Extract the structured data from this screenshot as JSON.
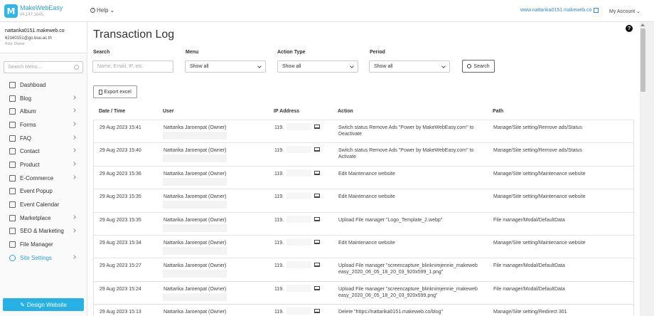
{
  "header": {
    "logo_letter": "M",
    "brand_name": "MakeWebEasy",
    "brand_version": "v4.147.1645",
    "help_label": "Help",
    "site_link": "www.nattarika0151.makeweb.co",
    "account_label": "My Account"
  },
  "sidebar": {
    "user_name": "nattarika0151.makeweb.co",
    "user_email": "62160151@go.buu.ac.th",
    "user_role": "Role: Owner",
    "search_placeholder": "Search Menu...",
    "items": [
      {
        "label": "Dashboad",
        "icon": "home-icon",
        "chevron": false
      },
      {
        "label": "Blog",
        "icon": "blog-icon",
        "chevron": true
      },
      {
        "label": "Album",
        "icon": "album-icon",
        "chevron": true
      },
      {
        "label": "Forms",
        "icon": "forms-icon",
        "chevron": true
      },
      {
        "label": "FAQ",
        "icon": "faq-icon",
        "chevron": true
      },
      {
        "label": "Contact",
        "icon": "mail-icon",
        "chevron": true
      },
      {
        "label": "Product",
        "icon": "cart-icon",
        "chevron": true
      },
      {
        "label": "E-Commerce",
        "icon": "ecommerce-icon",
        "chevron": true
      },
      {
        "label": "Event Popup",
        "icon": "megaphone-icon",
        "chevron": false
      },
      {
        "label": "Event Calendar",
        "icon": "calendar-icon",
        "chevron": false
      },
      {
        "label": "Marketplace",
        "icon": "marketplace-icon",
        "chevron": true
      },
      {
        "label": "SEO & Marketing",
        "icon": "seo-icon",
        "chevron": true
      },
      {
        "label": "File Manager",
        "icon": "folder-icon",
        "chevron": false
      },
      {
        "label": "Site Settings",
        "icon": "gear-icon",
        "chevron": true,
        "active": true
      }
    ],
    "design_button": "Design Website"
  },
  "main": {
    "title": "Transaction Log",
    "filters": {
      "search_label": "Search",
      "search_placeholder": "Name, Email, IP, etc.",
      "menu_label": "Menu",
      "menu_value": "Show all",
      "action_type_label": "Action Type",
      "action_type_value": "Show all",
      "period_label": "Period",
      "period_value": "Show all",
      "search_button": "Search"
    },
    "export_button": "Export excel",
    "table": {
      "columns": [
        "Date / Time",
        "User",
        "IP Address",
        "Action",
        "Path"
      ],
      "rows": [
        {
          "date": "29 Aug 2023 15:41",
          "user": "Nattarika Jaroenpat (Owner)",
          "ip": "119.",
          "action": "Switch status Remove Ads \"Power by MakeWebEasy.com\" to Deactivate",
          "path": "Manage/Site setting/Remove ads/Status"
        },
        {
          "date": "29 Aug 2023 15:40",
          "user": "Nattarika Jaroenpat (Owner)",
          "ip": "119.",
          "action": "Switch status Remove Ads \"Power by MakeWebEasy.com\" to Activate",
          "path": "Manage/Site setting/Remove ads/Status"
        },
        {
          "date": "29 Aug 2023 15:36",
          "user": "Nattarika Jaroenpat (Owner)",
          "ip": "119.",
          "action": "Edit Maintenance website",
          "path": "Manage/Site setting/Maintenance website"
        },
        {
          "date": "29 Aug 2023 15:35",
          "user": "Nattarika Jaroenpat (Owner)",
          "ip": "119.",
          "action": "Edit Maintenance website",
          "path": "Manage/Site setting/Maintenance website"
        },
        {
          "date": "29 Aug 2023 15:35",
          "user": "Nattarika Jaroenpat (Owner)",
          "ip": "119.",
          "action": "Upload File manager \"Logo_Template_2.webp\"",
          "path": "File manager/Modal/DefaultData"
        },
        {
          "date": "29 Aug 2023 15:34",
          "user": "Nattarika Jaroenpat (Owner)",
          "ip": "119.",
          "action": "Edit Maintenance website",
          "path": "Manage/Site setting/Maintenance website"
        },
        {
          "date": "29 Aug 2023 15:27",
          "user": "Nattarika Jaroenpat (Owner)",
          "ip": "119.",
          "action": "Upload File manager \"screencapture_blinknimjennie_makeweb easy_2020_06_05_18_20_03_920x599_1.png\"",
          "path": "File manager/Modal/DefaultData"
        },
        {
          "date": "29 Aug 2023 15:24",
          "user": "Nattarika Jaroenpat (Owner)",
          "ip": "119.",
          "action": "Upload File manager \"screencapture_blinknimjennie_makeweb easy_2020_06_05_18_20_03_920x599.png\"",
          "path": "File manager/Modal/DefaultData"
        },
        {
          "date": "29 Aug 2023 15:13",
          "user": "Nattarika Jaroenpat (Owner)",
          "ip": "119.",
          "action": "Delete \"https://nattarika0151.makeweb.co/blog\"",
          "path": "Manage/Site setting/Redirect 301"
        }
      ]
    }
  },
  "colors": {
    "accent": "#2fa3d6",
    "button": "#27b1e4"
  }
}
